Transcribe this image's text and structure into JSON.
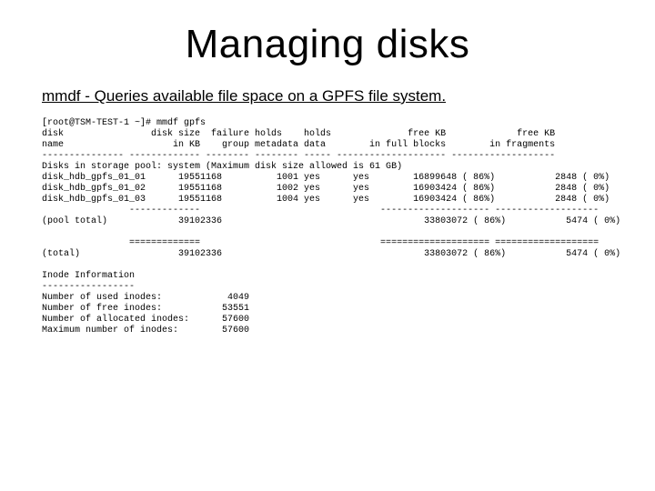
{
  "title": "Managing disks",
  "subtitle": "mmdf - Queries available file space on a GPFS file system.",
  "terminal": {
    "prompt": "[root@TSM-TEST-1 ~]# mmdf gpfs",
    "hdr1": "disk                disk size  failure holds    holds              free KB             free KB",
    "hdr2": "name                    in KB    group metadata data        in full blocks        in fragments",
    "sep1": "--------------- ------------- -------- -------- ----- -------------------- -------------------",
    "pool_line": "Disks in storage pool: system (Maximum disk size allowed is 61 GB)",
    "row1": "disk_hdb_gpfs_01_01      19551168          1001 yes      yes        16899648 ( 86%)           2848 ( 0%)",
    "row2": "disk_hdb_gpfs_01_02      19551168          1002 yes      yes        16903424 ( 86%)           2848 ( 0%)",
    "row3": "disk_hdb_gpfs_01_03      19551168          1004 yes      yes        16903424 ( 86%)           2848 ( 0%)",
    "sep2": "                -------------                                 -------------------- -------------------",
    "pool_total": "(pool total)             39102336                                     33803072 ( 86%)           5474 ( 0%)",
    "blank1": " ",
    "sep3": "                =============                                 ==================== ===================",
    "total": "(total)                  39102336                                     33803072 ( 86%)           5474 ( 0%)",
    "blank2": " ",
    "inode_hdr": "Inode Information",
    "inode_sep": "-----------------",
    "inode1": "Number of used inodes:            4049",
    "inode2": "Number of free inodes:           53551",
    "inode3": "Number of allocated inodes:      57600",
    "inode4": "Maximum number of inodes:        57600"
  }
}
